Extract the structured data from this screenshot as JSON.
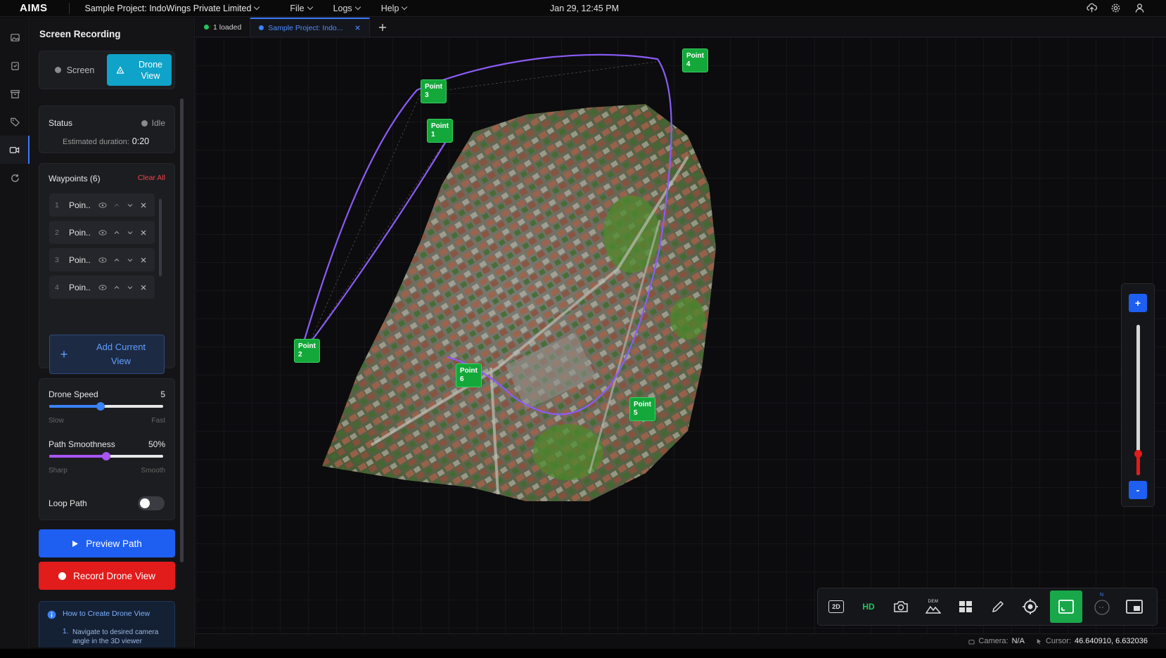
{
  "app": {
    "brand": "AIMS",
    "project": "Sample Project: IndoWings Private Limited",
    "menu": [
      "File",
      "Logs",
      "Help"
    ],
    "datetime": "Jan 29, 12:45 PM"
  },
  "icons": {
    "top": [
      "cloud-upload-icon",
      "gear-icon",
      "user-icon"
    ],
    "rail": [
      "image-icon",
      "clipboard-icon",
      "archive-icon",
      "tag-icon",
      "video-icon",
      "refresh-icon"
    ]
  },
  "panel": {
    "title": "Screen Recording",
    "modes": {
      "screen": "Screen",
      "drone_line1": "Drone",
      "drone_line2": "View"
    },
    "status": {
      "label": "Status",
      "value": "Idle",
      "duration_label": "Estimated duration:",
      "duration": "0:20"
    },
    "waypoints": {
      "title": "Waypoints (6)",
      "clear": "Clear All",
      "items": [
        {
          "num": "1",
          "name": "Poin.."
        },
        {
          "num": "2",
          "name": "Poin.."
        },
        {
          "num": "3",
          "name": "Poin.."
        },
        {
          "num": "4",
          "name": "Poin.."
        }
      ],
      "add_line1": "Add Current",
      "add_line2": "View"
    },
    "drone_speed": {
      "label": "Drone Speed",
      "value": "5",
      "level": 0.45,
      "min": "Slow",
      "max": "Fast"
    },
    "path_smoothness": {
      "label": "Path Smoothness",
      "value": "50%",
      "level": 0.5,
      "min": "Sharp",
      "max": "Smooth"
    },
    "loop_path": {
      "label": "Loop Path",
      "on": false
    },
    "preview_button": "Preview Path",
    "record_button": "Record Drone View",
    "howto": {
      "title": "How to Create Drone View",
      "step_num": "1.",
      "step_line1": "Navigate to desired camera",
      "step_line2": "angle in the 3D viewer"
    }
  },
  "tabs": [
    {
      "label": "1 loaded"
    },
    {
      "label": "Sample Project: Indo..."
    }
  ],
  "viewer": {
    "points": [
      {
        "label_a": "Point",
        "label_b": "1"
      },
      {
        "label_a": "Point",
        "label_b": "2"
      },
      {
        "label_a": "Point",
        "label_b": "3"
      },
      {
        "label_a": "Point",
        "label_b": "4"
      },
      {
        "label_a": "Point",
        "label_b": "5"
      },
      {
        "label_a": "Point",
        "label_b": "6"
      }
    ],
    "zoom": {
      "plus": "+",
      "minus": "-",
      "level": 0.14
    },
    "toolbar": {
      "mode_2d": "2D",
      "hd": "HD",
      "dem": "DEM",
      "compass_n": "N"
    }
  },
  "statusbar": {
    "camera_label": "Camera:",
    "camera_value": "N/A",
    "cursor_label": "Cursor:",
    "cursor_value": "46.640910, 6.632036"
  },
  "colors": {
    "accent": "#1e5ff2",
    "cyan": "#0fa3c9",
    "record": "#e21b1b",
    "waypoint": "#14a83a",
    "path": "#8b5cf6"
  }
}
